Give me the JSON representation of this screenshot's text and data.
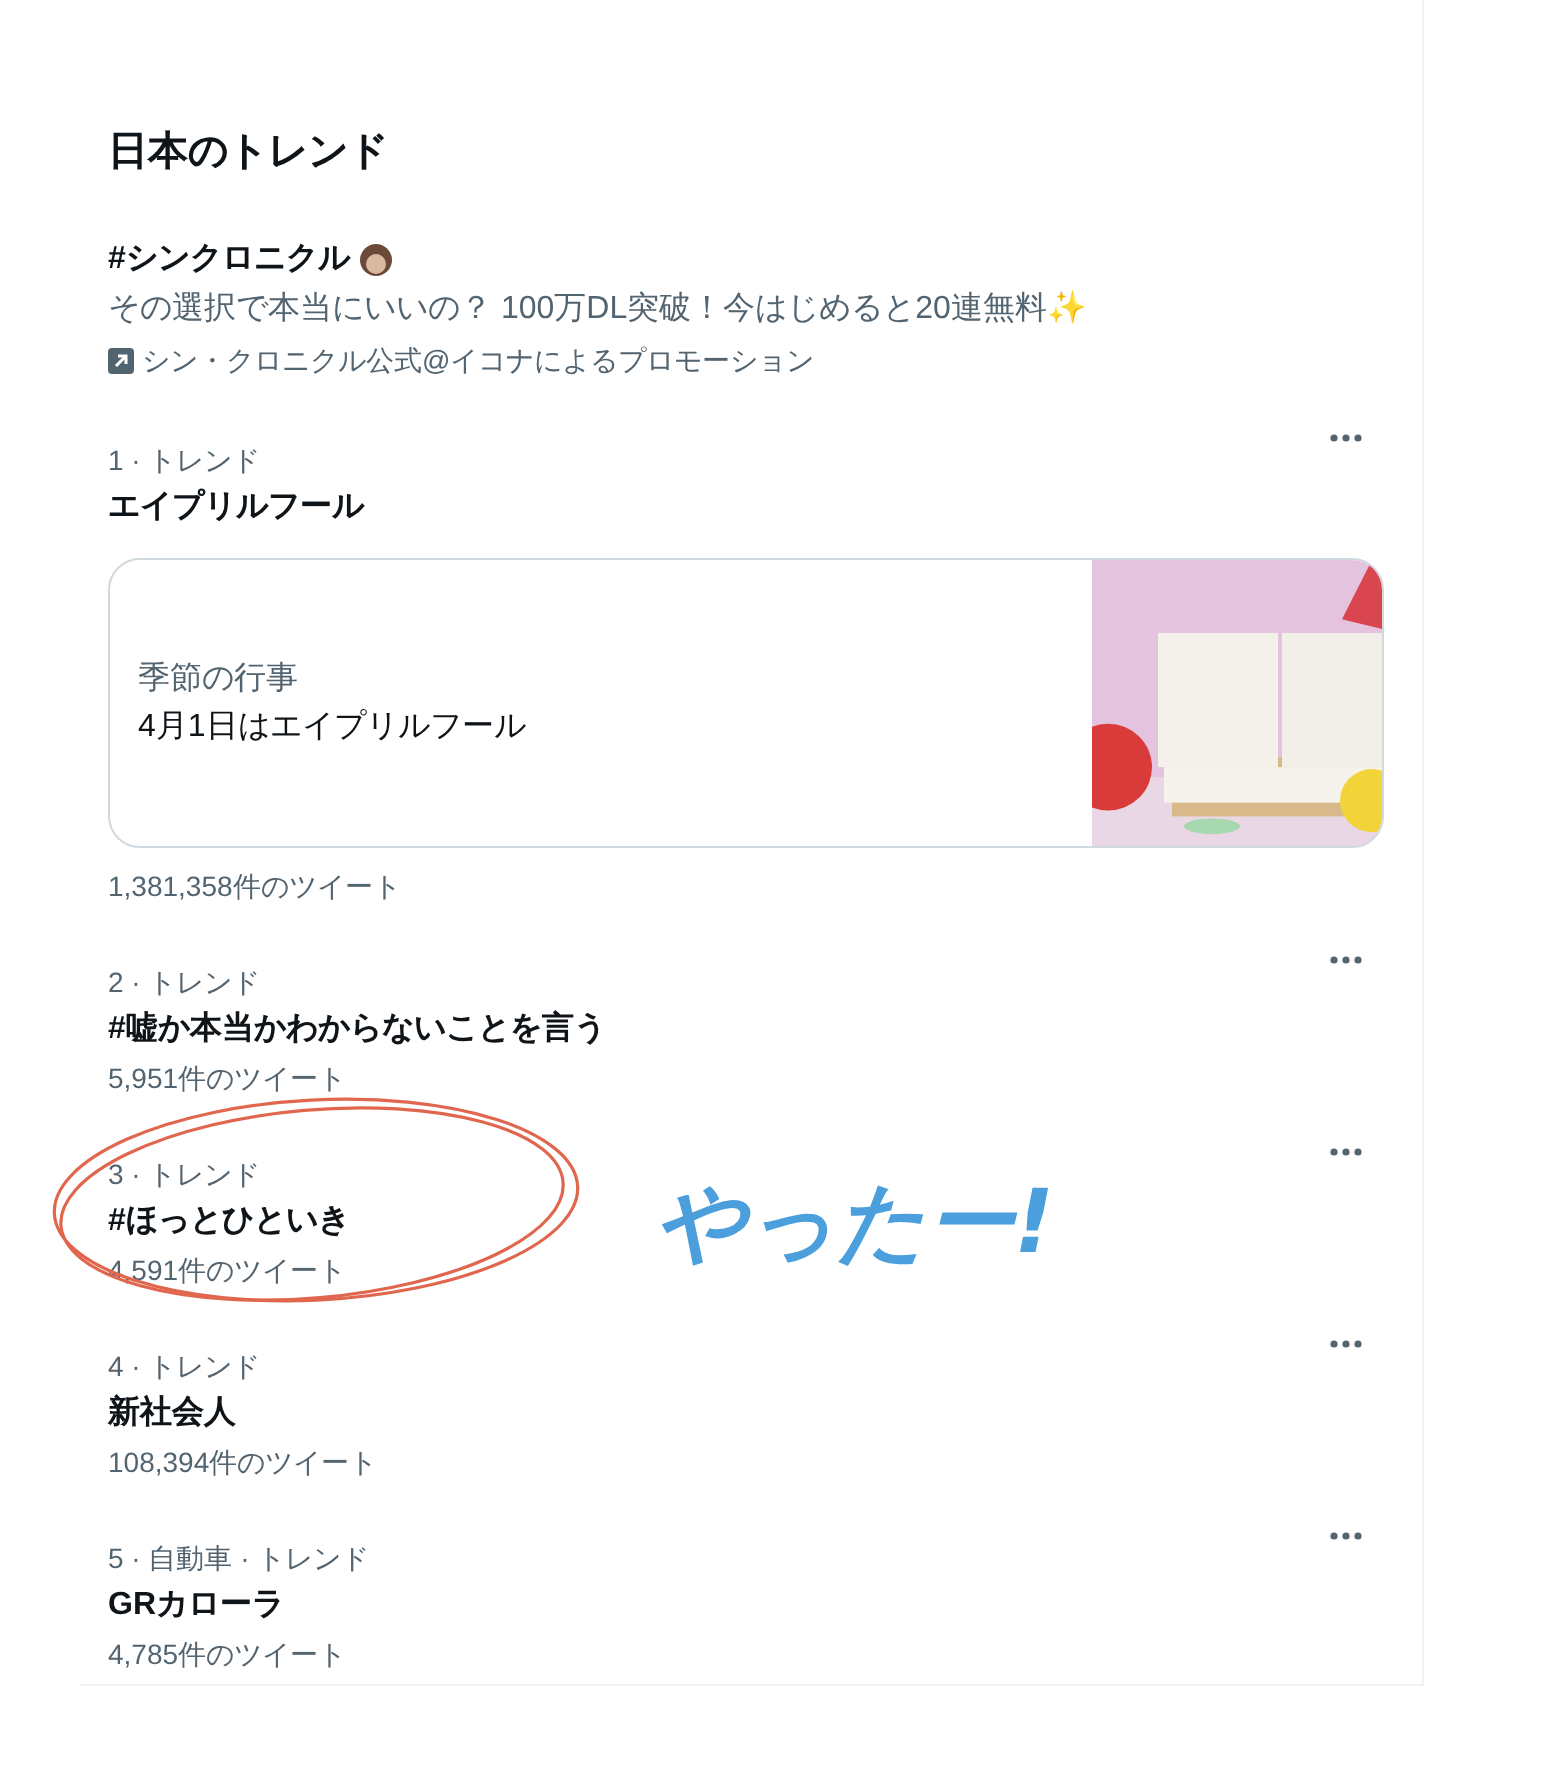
{
  "title": "日本のトレンド",
  "promoted": {
    "hashtag": "#シンクロニクル",
    "description": "その選択で本当にいいの？ 100万DL突破！今はじめると20連無料✨",
    "promoter": "シン・クロニクル公式@イコナによるプロモーション"
  },
  "trends": [
    {
      "meta": "1 · トレンド",
      "title": "エイプリルフール",
      "card": {
        "label": "季節の行事",
        "text": "4月1日はエイプリルフール",
        "kind": "picture"
      },
      "count": "1,381,358件のツイート"
    },
    {
      "meta": "2 · トレンド",
      "title": "#嘘か本当かわからないことを言う",
      "count": "5,951件のツイート"
    },
    {
      "meta": "3 · トレンド",
      "title": "#ほっとひといき",
      "count": "4,591件のツイート",
      "circled": true
    },
    {
      "meta": "4 · トレンド",
      "title": "新社会人",
      "count": "108,394件のツイート"
    },
    {
      "meta": "5 · 自動車 · トレンド",
      "title": "GRカローラ",
      "count": "4,785件のツイート"
    }
  ],
  "annotation": {
    "text": "やったー!"
  }
}
